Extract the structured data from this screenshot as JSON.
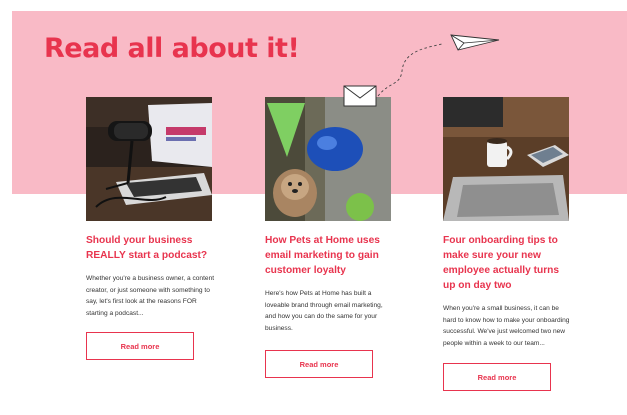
{
  "section": {
    "headline": "Read all about it!"
  },
  "colors": {
    "accent": "#e8344e",
    "band": "#f9bac6",
    "body_text": "#333333"
  },
  "icons": [
    "paper-plane-icon",
    "envelope-icon",
    "dotted-flight-path"
  ],
  "cards": [
    {
      "image": "podcast microphone and laptop",
      "title": "Should your business REALLY start a podcast?",
      "excerpt": "Whether you're a business owner, a content creator, or just someone with something to say, let's first look at the reasons FOR starting a podcast...",
      "button": "Read more"
    },
    {
      "image": "dog in a pet store",
      "title": "How Pets at Home uses email marketing to gain customer loyalty",
      "excerpt": "Here's how Pets at Home has built a loveable brand through email marketing, and how you can do the same for your business.",
      "button": "Read more"
    },
    {
      "image": "laptop, mug and phone on a desk",
      "title": "Four onboarding tips to make sure your new employee actually turns up on day two",
      "excerpt": "When you're a small business, it can be hard to know how to make your onboarding successful. We've just welcomed two new people within a week to our team...",
      "button": "Read more"
    }
  ]
}
